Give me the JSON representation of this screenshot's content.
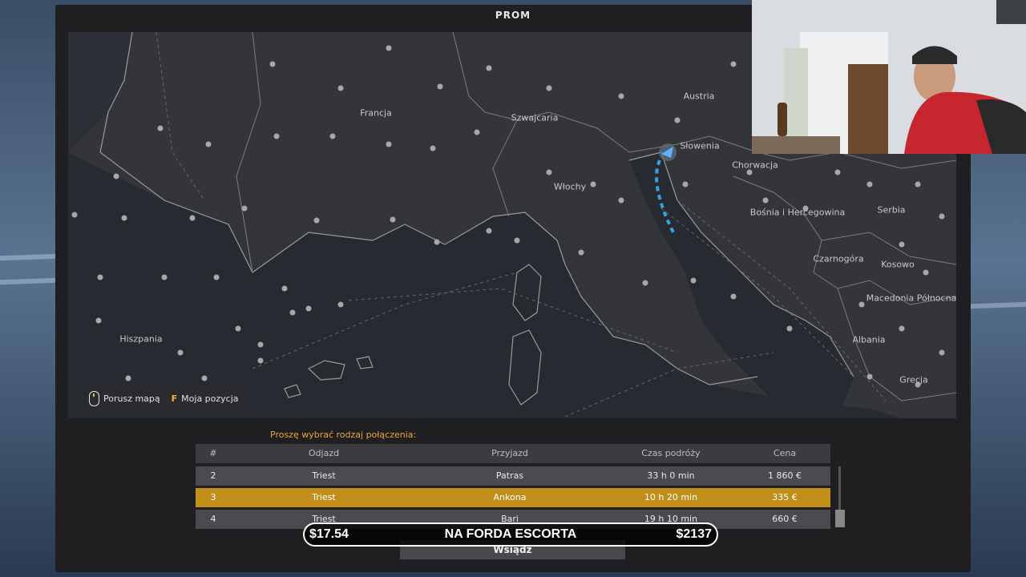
{
  "window": {
    "title": "PROM"
  },
  "map": {
    "countries": [
      {
        "name": "Francja"
      },
      {
        "name": "Szwajcaria"
      },
      {
        "name": "Austria"
      },
      {
        "name": "Słowenia"
      },
      {
        "name": "Chorwacja"
      },
      {
        "name": "Włochy"
      },
      {
        "name": "Bośnia i Hercegowina"
      },
      {
        "name": "Serbia"
      },
      {
        "name": "Czarnogóra"
      },
      {
        "name": "Kosowo"
      },
      {
        "name": "Macedonia Północna"
      },
      {
        "name": "Albania"
      },
      {
        "name": "Grecja"
      },
      {
        "name": "Hiszpania"
      }
    ],
    "legend": {
      "move_map_label": "Porusz mapą",
      "my_position_key": "F",
      "my_position_label": "Moja pozycja"
    },
    "route_color": "#3aa0e0"
  },
  "connections": {
    "prompt": "Proszę wybrać rodzaj połączenia:",
    "columns": [
      "#",
      "Odjazd",
      "Przyjazd",
      "Czas podróży",
      "Cena"
    ],
    "rows": [
      {
        "num": "2",
        "from": "Triest",
        "to": "Patras",
        "time": "33 h 0 min",
        "price": "1 860 €"
      },
      {
        "num": "3",
        "from": "Triest",
        "to": "Ankona",
        "time": "10 h 20 min",
        "price": "335 €",
        "selected": true
      },
      {
        "num": "4",
        "from": "Triest",
        "to": "Bari",
        "time": "19 h 10 min",
        "price": "660 €"
      }
    ],
    "selected_color": "#c18f19"
  },
  "buttons": {
    "enter": "Wsiądź"
  },
  "stream_overlay": {
    "left_amount": "$17.54",
    "center_text": "NA FORDA ESCORTA",
    "right_amount": "$2137"
  }
}
